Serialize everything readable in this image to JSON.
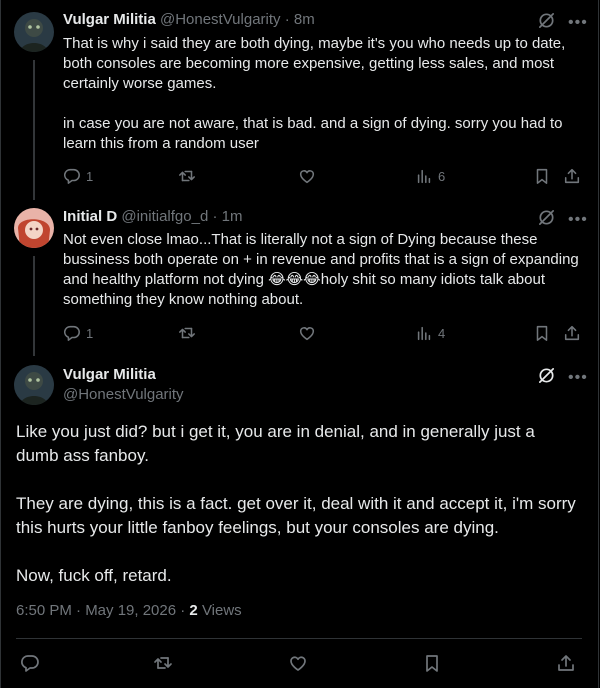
{
  "colors": {
    "background": "#000000",
    "text": "#e7e9ea",
    "muted": "#71767b",
    "border": "#2f3336"
  },
  "tweets": [
    {
      "name": "Vulgar Militia",
      "handle": "@HonestVulgarity",
      "time": "8m",
      "text": [
        "That is why i said they are both dying, maybe it's you who needs up to date, both consoles are becoming more expensive, getting less sales, and most certainly worse games.",
        "in case you are not aware, that is bad. and a sign of dying. sorry you had to learn this from a random user"
      ],
      "replies": "1",
      "views": "6"
    },
    {
      "name": "Initial D",
      "handle": "@initialfgo_d",
      "time": "1m",
      "text": [
        "Not even close lmao...That is literally not a sign of Dying because these bussiness both operate on + in revenue and profits that is a sign of expanding and healthy platform not dying 😂😂😂holy shit so many idiots talk about something they know nothing about."
      ],
      "replies": "1",
      "views": "4"
    }
  ],
  "main": {
    "name": "Vulgar Militia",
    "handle": "@HonestVulgarity",
    "paragraphs": [
      "Like you just did? but i get it, you are in denial, and in generally just a dumb ass fanboy.",
      "They are dying, this is a fact. get over it, deal with it and accept it, i'm sorry this hurts your little fanboy feelings, but your consoles are dying.",
      "Now, fuck off, retard."
    ],
    "timestamp": "6:50 PM · May 19, 2026 · ",
    "views_count": "2",
    "views_label": "Views"
  },
  "icons": [
    "reply-icon",
    "retweet-icon",
    "like-icon",
    "views-icon",
    "bookmark-icon",
    "share-icon",
    "grok-icon",
    "more-icon"
  ]
}
